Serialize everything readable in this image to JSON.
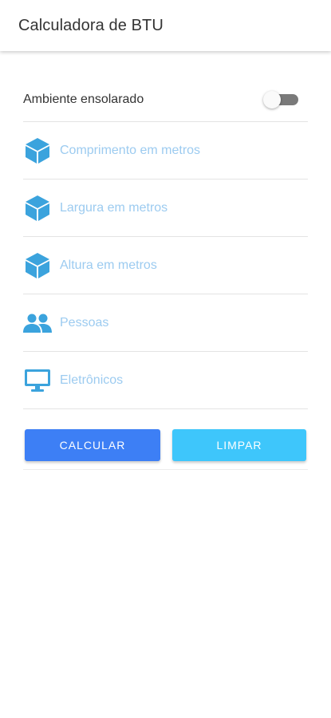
{
  "app_bar": {
    "title": "Calculadora de BTU"
  },
  "sunny_toggle": {
    "label": "Ambiente ensolarado",
    "on": false
  },
  "fields": [
    {
      "icon": "cube-icon",
      "placeholder": "Comprimento em metros",
      "value": ""
    },
    {
      "icon": "cube-icon",
      "placeholder": "Largura em metros",
      "value": ""
    },
    {
      "icon": "cube-icon",
      "placeholder": "Altura em metros",
      "value": ""
    },
    {
      "icon": "people-icon",
      "placeholder": "Pessoas",
      "value": ""
    },
    {
      "icon": "monitor-icon",
      "placeholder": "Eletrônicos",
      "value": ""
    }
  ],
  "buttons": {
    "calculate_label": "CALCULAR",
    "clear_label": "LIMPAR"
  },
  "colors": {
    "icon": "#3ba3dd",
    "placeholder": "#9ccbf0",
    "calculate_button": "#3d7ff5",
    "clear_button": "#3ec6fb",
    "switch_track": "#7a7a7a"
  }
}
